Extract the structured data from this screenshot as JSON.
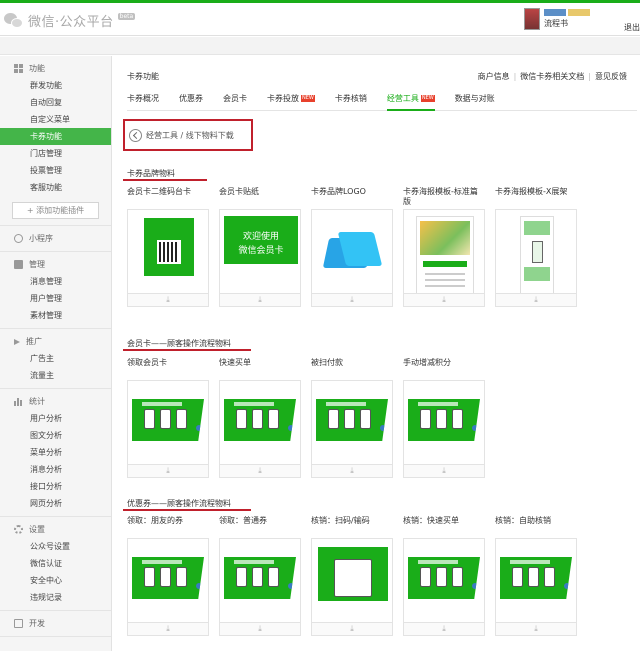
{
  "header": {
    "logo_text": "微信·公众平台",
    "beta_badge": "beta",
    "username": "流程书",
    "exit_label": "退出"
  },
  "sidebar": {
    "groups": [
      {
        "title": "功能",
        "icon": "grid-icon",
        "items": [
          "群发功能",
          "自动回复",
          "自定义菜单",
          "卡券功能",
          "门店管理",
          "投票管理",
          "客服功能"
        ],
        "add_button": "+ 添加功能插件"
      },
      {
        "title": "小程序",
        "icon": "miniprogram-icon",
        "items": []
      },
      {
        "title": "管理",
        "icon": "manage-icon",
        "items": [
          "消息管理",
          "用户管理",
          "素材管理"
        ]
      },
      {
        "title": "推广",
        "icon": "promote-icon",
        "items": [
          "广告主",
          "流量主"
        ]
      },
      {
        "title": "统计",
        "icon": "stats-icon",
        "items": [
          "用户分析",
          "图文分析",
          "菜单分析",
          "消息分析",
          "接口分析",
          "网页分析"
        ]
      },
      {
        "title": "设置",
        "icon": "settings-icon",
        "items": [
          "公众号设置",
          "微信认证",
          "安全中心",
          "违规记录"
        ]
      },
      {
        "title": "开发",
        "icon": "dev-icon",
        "items": []
      }
    ],
    "active_item": "卡券功能"
  },
  "main": {
    "page_title": "卡券功能",
    "top_links": [
      "商户信息",
      "微信卡券相关文档",
      "意见反馈"
    ],
    "tabs": [
      {
        "label": "卡券概况",
        "new": false
      },
      {
        "label": "优惠券",
        "new": false
      },
      {
        "label": "会员卡",
        "new": false
      },
      {
        "label": "卡券投放",
        "new": true
      },
      {
        "label": "卡券核销",
        "new": false
      },
      {
        "label": "经营工具",
        "new": true
      },
      {
        "label": "数据与对账",
        "new": false
      }
    ],
    "active_tab": "经营工具",
    "new_badge": "NEW",
    "breadcrumb": "经营工具 / 线下物料下载",
    "download_icon_glyph": "⤓",
    "sections": [
      {
        "title": "卡券品牌物料",
        "cards": [
          {
            "label": "会员卡二维码台卡",
            "art": "qr-standee"
          },
          {
            "label": "会员卡贴纸",
            "art": "sticker",
            "sticker_text": "欢迎使用\n微信会员卡"
          },
          {
            "label": "卡券品牌LOGO",
            "art": "card-logo"
          },
          {
            "label": "卡券海报模板-标准篇版",
            "art": "poster"
          },
          {
            "label": "卡券海报模板-X展架",
            "art": "x-banner"
          }
        ]
      },
      {
        "title": "会员卡——顾客操作流程物料",
        "cards": [
          {
            "label": "领取会员卡",
            "art": "flow"
          },
          {
            "label": "快速买单",
            "art": "flow"
          },
          {
            "label": "被扫付款",
            "art": "flow"
          },
          {
            "label": "手动增减积分",
            "art": "flow"
          }
        ]
      },
      {
        "title": "优惠券——顾客操作流程物料",
        "cards": [
          {
            "label": "领取：朋友的券",
            "art": "flow"
          },
          {
            "label": "领取：普通券",
            "art": "flow"
          },
          {
            "label": "核销：扫码/输码",
            "art": "big-phone"
          },
          {
            "label": "核销：快速买单",
            "art": "flow"
          },
          {
            "label": "核销：自助核销",
            "art": "flow"
          }
        ]
      }
    ]
  },
  "colors": {
    "brand_green": "#1aad19",
    "sidebar_active": "#44b549",
    "annotation_red": "#c0202c",
    "new_badge": "#e8412c"
  }
}
